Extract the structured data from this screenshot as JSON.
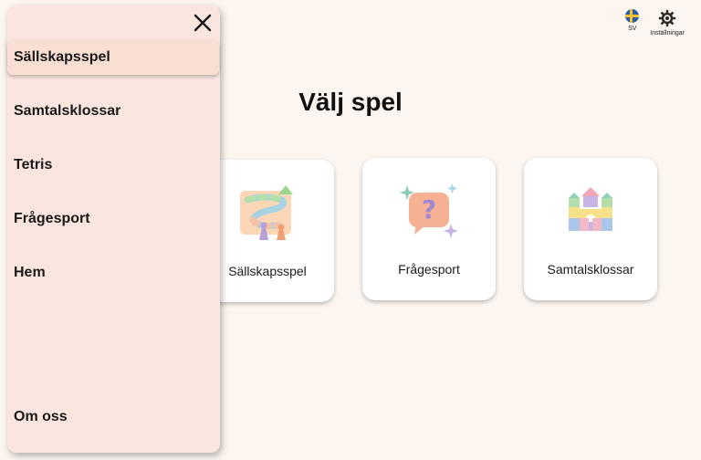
{
  "header": {
    "language_label": "SV",
    "settings_label": "Inställningar"
  },
  "main": {
    "title": "Välj spel",
    "cards": [
      {
        "label": "Sällskapsspel",
        "icon": "board-game-icon"
      },
      {
        "label": "Frågesport",
        "icon": "question-bubble-icon"
      },
      {
        "label": "Samtalsklossar",
        "icon": "blocks-castle-icon"
      }
    ]
  },
  "drawer": {
    "items": [
      {
        "label": "Sällskapsspel",
        "active": true
      },
      {
        "label": "Samtalsklossar"
      },
      {
        "label": "Tetris"
      },
      {
        "label": "Frågesport"
      },
      {
        "label": "Hem"
      }
    ],
    "footer_item": "Om oss"
  },
  "colors": {
    "background": "#fdf5ef",
    "drawer": "#fbe6df",
    "active_item": "#f9ded4"
  }
}
